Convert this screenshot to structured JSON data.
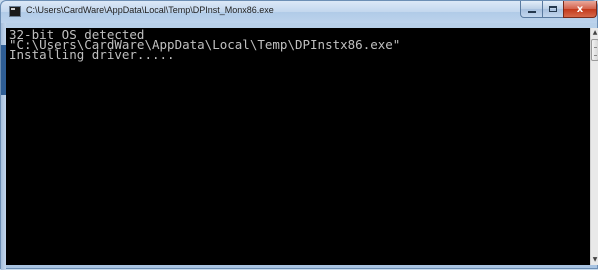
{
  "window": {
    "title": "C:\\Users\\CardWare\\AppData\\Local\\Temp\\DPInst_Monx86.exe",
    "icon": "console-icon",
    "controls": {
      "minimize": "",
      "maximize": "",
      "close": "x"
    }
  },
  "console": {
    "lines": [
      "32-bit OS detected",
      "\"C:\\Users\\CardWare\\AppData\\Local\\Temp\\DPInstx86.exe\"",
      "Installing driver....."
    ],
    "background": "#000000",
    "foreground": "#c0c0c0"
  },
  "scrollbar": {
    "up_arrow": "▲",
    "down_arrow": "▼"
  }
}
